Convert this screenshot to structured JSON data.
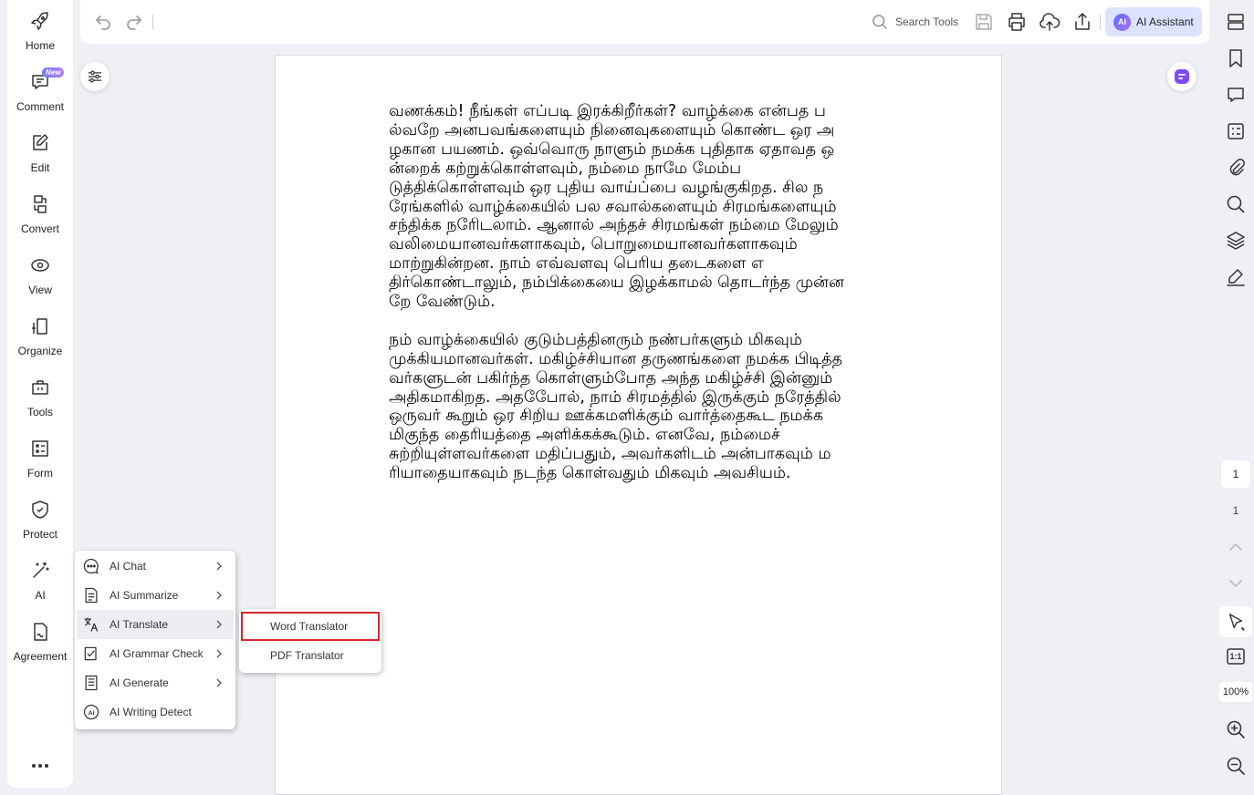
{
  "sidebar": {
    "items": [
      {
        "label": "Home",
        "icon": "rocket-icon"
      },
      {
        "label": "Comment",
        "icon": "comment-icon"
      },
      {
        "label": "Edit",
        "icon": "edit-icon"
      },
      {
        "label": "Convert",
        "icon": "convert-icon"
      },
      {
        "label": "View",
        "icon": "eye-icon"
      },
      {
        "label": "Organize",
        "icon": "organize-icon"
      },
      {
        "label": "Tools",
        "icon": "toolbox-icon"
      },
      {
        "label": "Form",
        "icon": "form-icon"
      },
      {
        "label": "Protect",
        "icon": "shield-icon"
      },
      {
        "label": "AI",
        "icon": "magic-wand-icon"
      },
      {
        "label": "Agreement",
        "icon": "agreement-icon",
        "badge": "New"
      }
    ],
    "more_icon": "more-dots-icon"
  },
  "toolbar": {
    "search_placeholder": "Search Tools",
    "ai_assistant_label": "AI Assistant",
    "ai_logo_text": "AI",
    "icons": [
      "undo-icon",
      "redo-icon",
      "search-icon",
      "save-icon",
      "print-icon",
      "cloud-upload-icon",
      "share-icon"
    ]
  },
  "document": {
    "paragraphs": [
      "வணக்கம்! நீங்கள் எப்படி இரக்கிறீர்கள்? வாழ்க்கை என்பத பல்வறே அனபவங்களையும் நினைவுகளையும் கொண்ட ஒர அழகான பயணம். ஒவ்வொரு நாளும் நமக்க புதிதாக ஏதாவத ஒன்றைக் கற்றுக்கொள்ளவும், நம்மை நாமே மேம்படுத்திக்கொள்ளவும் ஒர புதிய வாய்ப்பை வழங்குகிறத. சில நரேங்களில் வாழ்க்கையில் பல சவால்களையும் சிரமங்களையும் சந்திக்க நரேிடலாம். ஆனால் அந்தச் சிரமங்கள் நம்மை மேலும் வலிமையானவர்களாகவும், பொறுமையானவர்களாகவும் மாற்றுகின்றன. நாம் எவ்வளவு பெரிய தடைகளை எதிர்கொண்டாலும், நம்பிக்கையை இழக்காமல் தொடர்ந்த முன்னறே வேண்டும்.",
      "நம் வாழ்க்கையில் குடும்பத்தினரும் நண்பர்களும் மிகவும் முக்கியமானவர்கள். மகிழ்ச்சியான தருணங்களை நமக்க பிடித்தவர்களுடன் பகிர்ந்த கொள்ளும்போத அந்த மகிழ்ச்சி இன்னும் அதிகமாகிறத. அதபேோல், நாம் சிரமத்தில் இருக்கும் நரேத்தில் ஒருவர் கூறும் ஒர சிறிய ஊக்கமளிக்கும் வார்த்தைகூட நமக்க மிகுந்த தைரியத்தை அளிக்கக்கூடும். எனவே, நம்மைச் சுற்றியுள்ளவர்களை மதிப்பதும், அவர்களிடம் அன்பாகவும் மரியாதையாகவும் நடந்த கொள்வதும் மிகவும் அவசியம்."
    ]
  },
  "ai_menu": {
    "items": [
      {
        "label": "AI Chat",
        "icon": "chat-icon",
        "has_submenu": true
      },
      {
        "label": "AI Summarize",
        "icon": "summarize-icon",
        "has_submenu": true
      },
      {
        "label": "AI Translate",
        "icon": "translate-icon",
        "has_submenu": true,
        "active": true
      },
      {
        "label": "AI Grammar Check",
        "icon": "grammar-check-icon",
        "has_submenu": true
      },
      {
        "label": "AI Generate",
        "icon": "generate-icon",
        "has_submenu": true
      },
      {
        "label": "AI Writing Detect",
        "icon": "ai-detect-icon",
        "has_submenu": false
      }
    ]
  },
  "translate_submenu": {
    "items": [
      {
        "label": "Word Translator",
        "highlighted": true
      },
      {
        "label": "PDF Translator",
        "highlighted": false
      }
    ]
  },
  "right_sidebar": {
    "current_page": "1",
    "total_pages": "1",
    "zoom": "100%",
    "fit_label": "1:1",
    "icons": [
      "panel-icon",
      "bookmark-icon",
      "comments-panel-icon",
      "form-fields-icon",
      "attachment-icon",
      "search-panel-icon",
      "layers-icon",
      "signature-icon",
      "page-up-icon",
      "page-down-icon",
      "select-tool-icon",
      "actual-size-icon",
      "zoom-in-icon",
      "zoom-out-icon"
    ]
  },
  "colors": {
    "accent": "#5b6dff",
    "highlight_border": "#d9262c",
    "ai_button_bg": "#dde3ff"
  }
}
